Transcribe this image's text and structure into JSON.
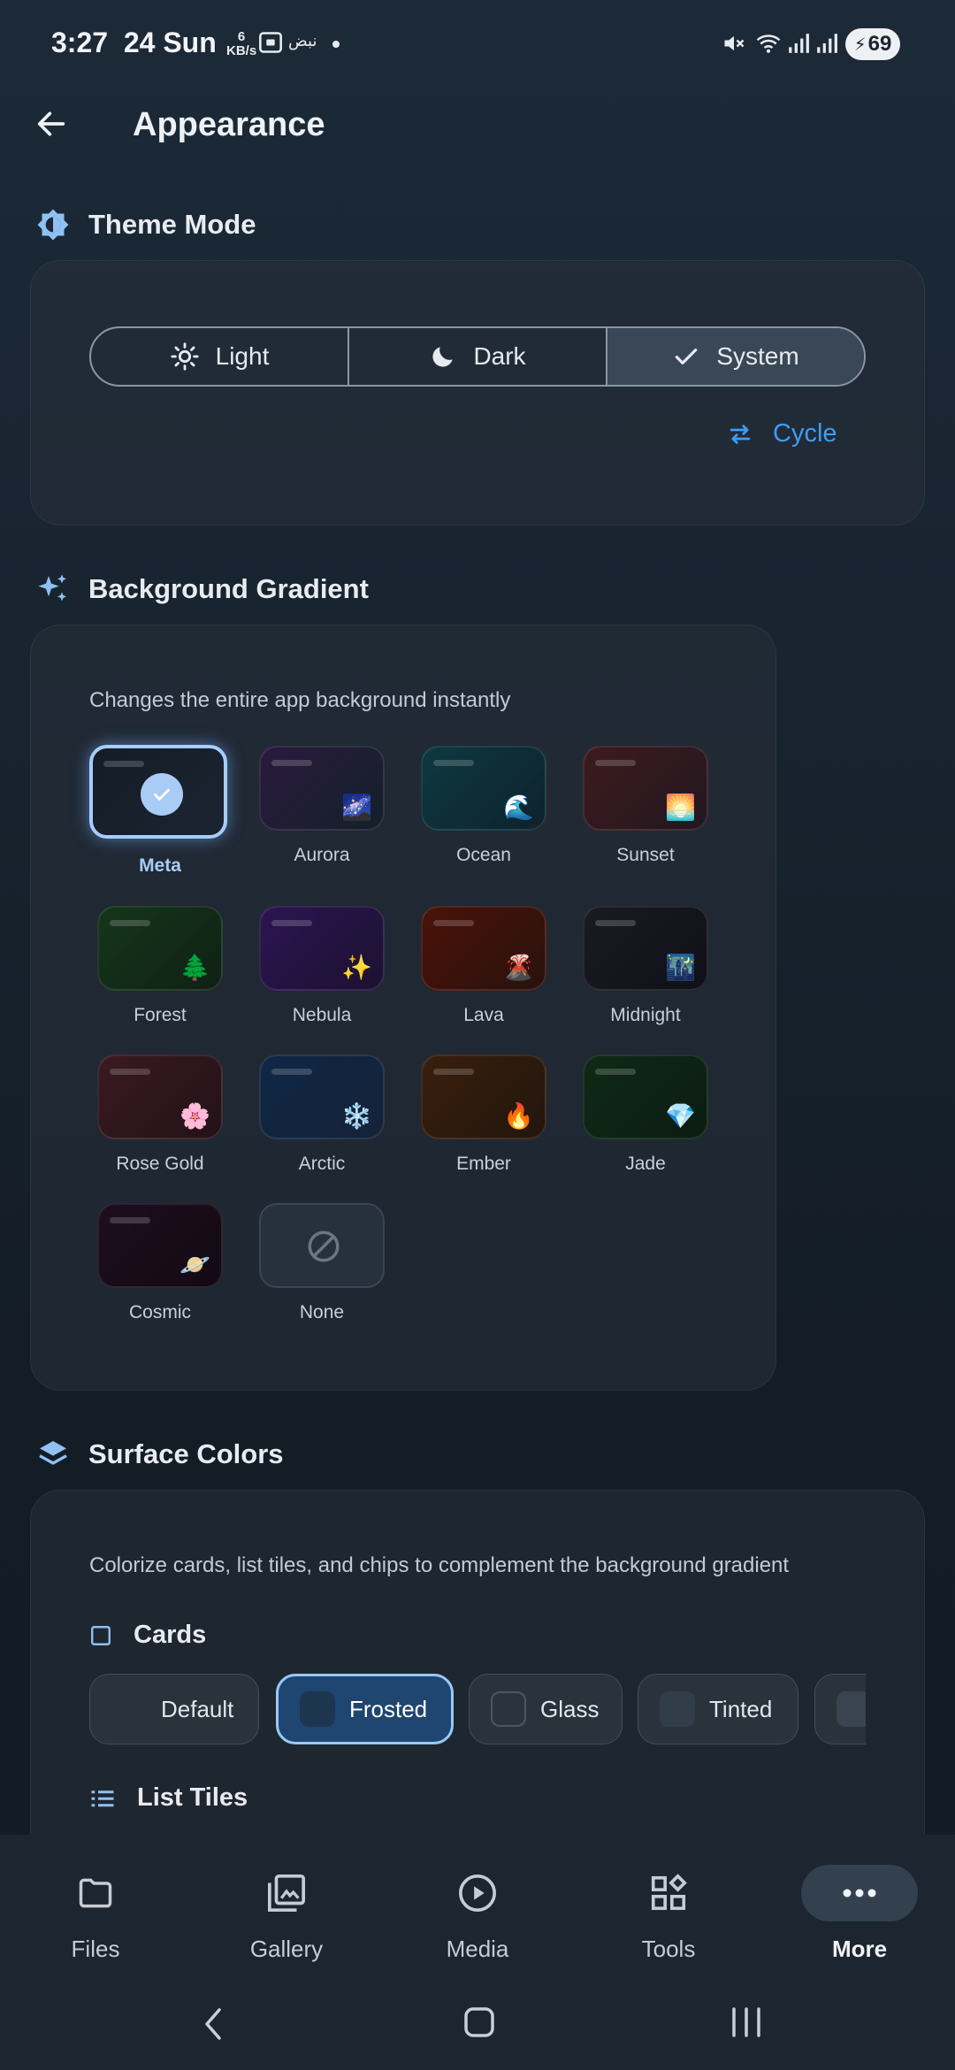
{
  "status_bar": {
    "time": "3:27",
    "date": "24 Sun",
    "net_speed": "6",
    "net_unit": "KB/s",
    "lang": "نبض",
    "battery": "69"
  },
  "app_bar": {
    "title": "Appearance"
  },
  "theme_mode": {
    "title": "Theme Mode",
    "options": [
      {
        "label": "Light",
        "icon": "sun-icon"
      },
      {
        "label": "Dark",
        "icon": "moon-icon"
      },
      {
        "label": "System",
        "icon": "check-icon"
      }
    ],
    "selected": "System",
    "cycle_label": "Cycle"
  },
  "background_gradient": {
    "title": "Background Gradient",
    "subtitle": "Changes the entire app background instantly",
    "selected": "Meta",
    "items": [
      {
        "name": "Meta",
        "emoji": "",
        "color1": "#141c27",
        "color2": "#1b2430"
      },
      {
        "name": "Aurora",
        "emoji": "🌌",
        "color1": "#2a1a3e",
        "color2": "#14202a"
      },
      {
        "name": "Ocean",
        "emoji": "🌊",
        "color1": "#0d3940",
        "color2": "#0e222d"
      },
      {
        "name": "Sunset",
        "emoji": "🌅",
        "color1": "#3d1a1e",
        "color2": "#221820"
      },
      {
        "name": "Forest",
        "emoji": "🌲",
        "color1": "#15361a",
        "color2": "#0f2015"
      },
      {
        "name": "Nebula",
        "emoji": "✨",
        "color1": "#2c1452",
        "color2": "#1c1230"
      },
      {
        "name": "Lava",
        "emoji": "🌋",
        "color1": "#4a1208",
        "color2": "#2a120e"
      },
      {
        "name": "Midnight",
        "emoji": "🌃",
        "color1": "#1a1a22",
        "color2": "#101018"
      },
      {
        "name": "Rose Gold",
        "emoji": "🌸",
        "color1": "#3a1a20",
        "color2": "#221218"
      },
      {
        "name": "Arctic",
        "emoji": "❄️",
        "color1": "#0f2746",
        "color2": "#152238"
      },
      {
        "name": "Ember",
        "emoji": "🔥",
        "color1": "#3a1e0c",
        "color2": "#22160e"
      },
      {
        "name": "Jade",
        "emoji": "💎",
        "color1": "#0f2a16",
        "color2": "#0c1c12"
      },
      {
        "name": "Cosmic",
        "emoji": "🪐",
        "color1": "#1e0e1e",
        "color2": "#120a14"
      },
      {
        "name": "None",
        "emoji": "",
        "color1": "#26313d",
        "color2": "#26313d"
      }
    ]
  },
  "surface_colors": {
    "title": "Surface Colors",
    "subtitle": "Colorize cards, list tiles, and chips to complement the background gradient",
    "cards_label": "Cards",
    "card_styles": [
      {
        "label": "Default",
        "swatch": "#2a323c"
      },
      {
        "label": "Frosted",
        "swatch": "#1e3550"
      },
      {
        "label": "Glass",
        "swatch": "#2b333c"
      },
      {
        "label": "Tinted",
        "swatch": "#323d4a"
      },
      {
        "label": "",
        "swatch": "#3a4350"
      }
    ],
    "selected_card_style": "Frosted",
    "list_tiles_label": "List Tiles"
  },
  "bottom_nav": {
    "items": [
      {
        "label": "Files",
        "icon": "folder-icon"
      },
      {
        "label": "Gallery",
        "icon": "gallery-icon"
      },
      {
        "label": "Media",
        "icon": "play-circle-icon"
      },
      {
        "label": "Tools",
        "icon": "tools-icon"
      },
      {
        "label": "More",
        "icon": "more-icon"
      }
    ],
    "active": "More"
  },
  "colors": {
    "accent": "#3d9df2",
    "selected_tile_border": "#a6cdfb",
    "selected_chip_bg": "#1f4670"
  }
}
